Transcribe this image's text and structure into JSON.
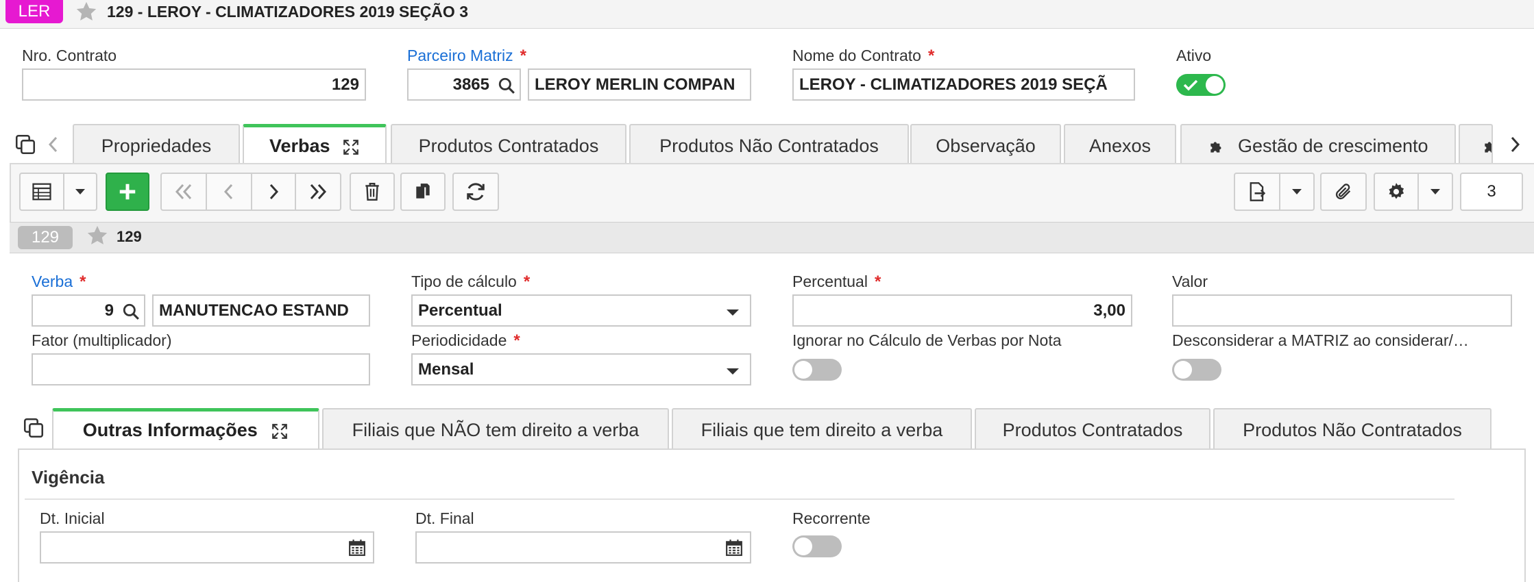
{
  "header": {
    "badge": "LER",
    "title": "129 - LEROY - CLIMATIZADORES 2019 SEÇÃO 3"
  },
  "contract": {
    "nro_label": "Nro. Contrato",
    "nro_value": "129",
    "parceiro_label": "Parceiro Matriz",
    "parceiro_code": "3865",
    "parceiro_name": "LEROY MERLIN COMPAN",
    "nome_label": "Nome do Contrato",
    "nome_value": "LEROY - CLIMATIZADORES 2019 SEÇÃ",
    "ativo_label": "Ativo",
    "ativo_value": true,
    "required_mark": "*"
  },
  "main_tabs": [
    {
      "label": "Propriedades",
      "active": false
    },
    {
      "label": "Verbas",
      "active": true
    },
    {
      "label": "Produtos Contratados",
      "active": false
    },
    {
      "label": "Produtos Não Contratados",
      "active": false
    },
    {
      "label": "Observação",
      "active": false
    },
    {
      "label": "Anexos",
      "active": false
    },
    {
      "label": "Gestão de crescimento",
      "active": false
    }
  ],
  "toolbar": {
    "page_count": "3"
  },
  "record": {
    "badge": "129",
    "label": "129"
  },
  "verba": {
    "verba_label": "Verba",
    "verba_code": "9",
    "verba_name": "MANUTENCAO ESTAND",
    "tipo_label": "Tipo de cálculo",
    "tipo_value": "Percentual",
    "percentual_label": "Percentual",
    "percentual_value": "3,00",
    "valor_label": "Valor",
    "valor_value": "",
    "fator_label": "Fator (multiplicador)",
    "fator_value": "",
    "periodicidade_label": "Periodicidade",
    "periodicidade_value": "Mensal",
    "ignorar_label": "Ignorar no Cálculo de Verbas por Nota",
    "ignorar_value": false,
    "desconsiderar_label": "Desconsiderar a MATRIZ ao considerar/…",
    "desconsiderar_value": false
  },
  "sub_tabs": [
    {
      "label": "Outras Informações",
      "active": true
    },
    {
      "label": "Filiais que NÃO tem direito a verba",
      "active": false
    },
    {
      "label": "Filiais que tem direito a verba",
      "active": false
    },
    {
      "label": "Produtos Contratados",
      "active": false
    },
    {
      "label": "Produtos Não Contratados",
      "active": false
    }
  ],
  "vigencia": {
    "title": "Vigência",
    "dt_inicial_label": "Dt. Inicial",
    "dt_inicial_value": "",
    "dt_final_label": "Dt. Final",
    "dt_final_value": "",
    "recorrente_label": "Recorrente",
    "recorrente_value": false
  },
  "colors": {
    "badge": "#e619d1",
    "active_tab": "#3fc45a",
    "toggle_on": "#2db84d",
    "link": "#1a6fd6",
    "required": "#e02b2b"
  }
}
